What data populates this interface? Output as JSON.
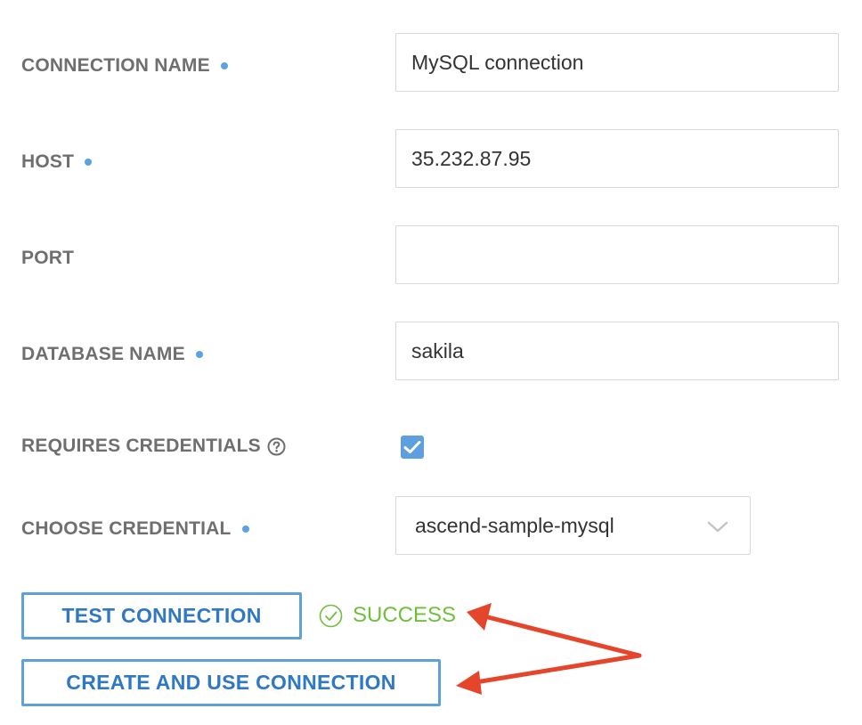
{
  "form": {
    "connection_name": {
      "label": "CONNECTION NAME",
      "value": "MySQL connection",
      "required": true
    },
    "host": {
      "label": "HOST",
      "value": "35.232.87.95",
      "required": true
    },
    "port": {
      "label": "PORT",
      "value": "",
      "required": false
    },
    "database_name": {
      "label": "DATABASE NAME",
      "value": "sakila",
      "required": true
    },
    "requires_credentials": {
      "label": "REQUIRES CREDENTIALS",
      "checked": true,
      "help_icon": "question-circle-icon"
    },
    "choose_credential": {
      "label": "CHOOSE CREDENTIAL",
      "selected": "ascend-sample-mysql",
      "required": true
    }
  },
  "actions": {
    "test_label": "TEST CONNECTION",
    "create_label": "CREATE AND USE CONNECTION"
  },
  "status": {
    "text": "SUCCESS",
    "icon": "check-circle-icon"
  },
  "colors": {
    "accent": "#2f78c4",
    "button_border": "#5ea0d8",
    "required_dot": "#5aa2e0",
    "success": "#6fbf3e",
    "annotation_arrow": "#e5452b"
  }
}
